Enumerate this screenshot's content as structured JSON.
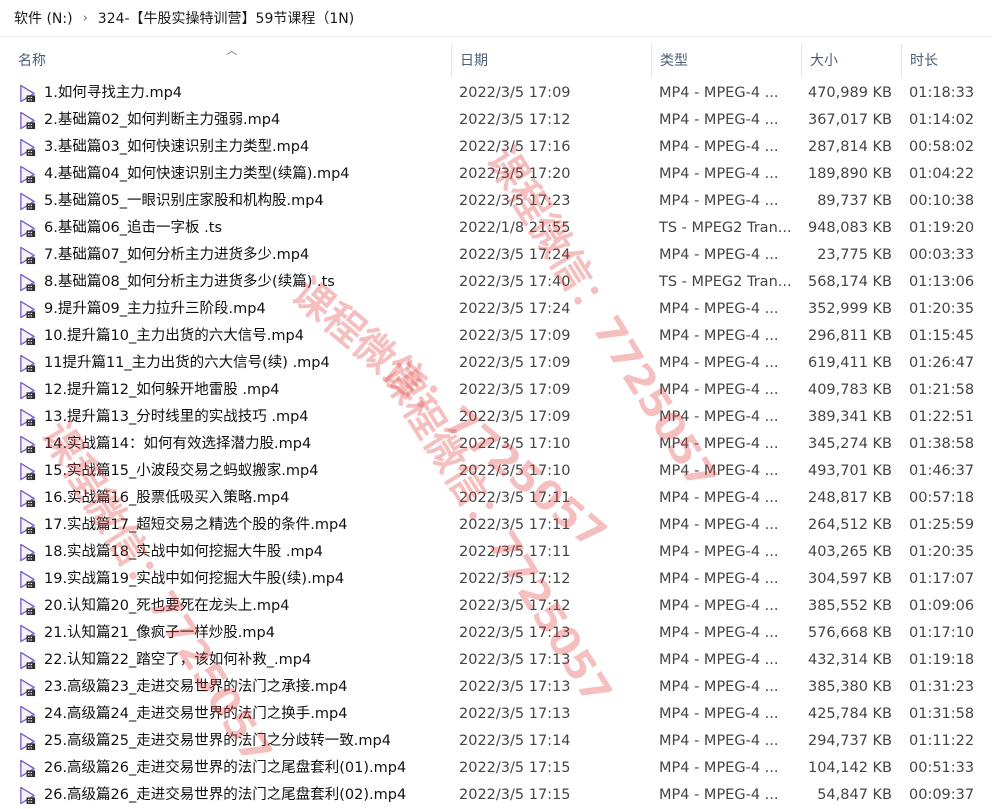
{
  "breadcrumb": [
    "软件 (N:)",
    "324-【牛股实操特训营】59节课程（1N)"
  ],
  "columns": {
    "name": "名称",
    "date": "日期",
    "type": "类型",
    "size": "大小",
    "duration": "时长"
  },
  "rows": [
    {
      "name": "1.如何寻找主力.mp4",
      "date": "2022/3/5 17:09",
      "type": "MP4 - MPEG-4 ...",
      "size": "470,989 KB",
      "duration": "01:18:33",
      "icon": "video-file-icon"
    },
    {
      "name": "2.基础篇02_如何判断主力强弱.mp4",
      "date": "2022/3/5 17:12",
      "type": "MP4 - MPEG-4 ...",
      "size": "367,017 KB",
      "duration": "01:14:02",
      "icon": "video-file-icon"
    },
    {
      "name": "3.基础篇03_如何快速识别主力类型.mp4",
      "date": "2022/3/5 17:16",
      "type": "MP4 - MPEG-4 ...",
      "size": "287,814 KB",
      "duration": "00:58:02",
      "icon": "video-file-icon"
    },
    {
      "name": "4.基础篇04_如何快速识别主力类型(续篇).mp4",
      "date": "2022/3/5 17:20",
      "type": "MP4 - MPEG-4 ...",
      "size": "189,890 KB",
      "duration": "01:04:22",
      "icon": "video-file-icon"
    },
    {
      "name": "5.基础篇05_一眼识别庄家股和机构股.mp4",
      "date": "2022/3/5 17:23",
      "type": "MP4 - MPEG-4 ...",
      "size": "89,737 KB",
      "duration": "00:10:38",
      "icon": "video-file-icon"
    },
    {
      "name": "6.基础篇06_追击一字板 .ts",
      "date": "2022/1/8 21:55",
      "type": "TS - MPEG2 Tran...",
      "size": "948,083 KB",
      "duration": "01:19:20",
      "icon": "video-file-icon"
    },
    {
      "name": "7.基础篇07_如何分析主力进货多少.mp4",
      "date": "2022/3/5 17:24",
      "type": "MP4 - MPEG-4 ...",
      "size": "23,775 KB",
      "duration": "00:03:33",
      "icon": "video-file-icon"
    },
    {
      "name": "8.基础篇08_如何分析主力进货多少(续篇) .ts",
      "date": "2022/3/5 17:40",
      "type": "TS - MPEG2 Tran...",
      "size": "568,174 KB",
      "duration": "01:13:06",
      "icon": "video-file-icon"
    },
    {
      "name": "9.提升篇09_主力拉升三阶段.mp4",
      "date": "2022/3/5 17:24",
      "type": "MP4 - MPEG-4 ...",
      "size": "352,999 KB",
      "duration": "01:20:35",
      "icon": "video-file-icon"
    },
    {
      "name": "10.提升篇10_主力出货的六大信号.mp4",
      "date": "2022/3/5 17:09",
      "type": "MP4 - MPEG-4 ...",
      "size": "296,811 KB",
      "duration": "01:15:45",
      "icon": "video-file-icon"
    },
    {
      "name": "11提升篇11_主力出货的六大信号(续) .mp4",
      "date": "2022/3/5 17:09",
      "type": "MP4 - MPEG-4 ...",
      "size": "619,411 KB",
      "duration": "01:26:47",
      "icon": "video-file-icon"
    },
    {
      "name": "12.提升篇12_如何躲开地雷股 .mp4",
      "date": "2022/3/5 17:09",
      "type": "MP4 - MPEG-4 ...",
      "size": "409,783 KB",
      "duration": "01:21:58",
      "icon": "video-file-icon"
    },
    {
      "name": "13.提升篇13_分时线里的实战技巧 .mp4",
      "date": "2022/3/5 17:09",
      "type": "MP4 - MPEG-4 ...",
      "size": "389,341 KB",
      "duration": "01:22:51",
      "icon": "video-file-icon"
    },
    {
      "name": "14.实战篇14：如何有效选择潜力股.mp4",
      "date": "2022/3/5 17:10",
      "type": "MP4 - MPEG-4 ...",
      "size": "345,274 KB",
      "duration": "01:38:58",
      "icon": "video-file-icon"
    },
    {
      "name": "15.实战篇15_小波段交易之蚂蚁搬家.mp4",
      "date": "2022/3/5 17:10",
      "type": "MP4 - MPEG-4 ...",
      "size": "493,701 KB",
      "duration": "01:46:37",
      "icon": "video-file-icon"
    },
    {
      "name": "16.实战篇16_股票低吸买入策略.mp4",
      "date": "2022/3/5 17:11",
      "type": "MP4 - MPEG-4 ...",
      "size": "248,817 KB",
      "duration": "00:57:18",
      "icon": "video-file-icon"
    },
    {
      "name": "17.实战篇17_超短交易之精选个股的条件.mp4",
      "date": "2022/3/5 17:11",
      "type": "MP4 - MPEG-4 ...",
      "size": "264,512 KB",
      "duration": "01:25:59",
      "icon": "video-file-icon"
    },
    {
      "name": "18.实战篇18_实战中如何挖掘大牛股 .mp4",
      "date": "2022/3/5 17:11",
      "type": "MP4 - MPEG-4 ...",
      "size": "403,265 KB",
      "duration": "01:20:35",
      "icon": "video-file-icon"
    },
    {
      "name": "19.实战篇19_实战中如何挖掘大牛股(续).mp4",
      "date": "2022/3/5 17:12",
      "type": "MP4 - MPEG-4 ...",
      "size": "304,597 KB",
      "duration": "01:17:07",
      "icon": "video-file-icon"
    },
    {
      "name": "20.认知篇20_死也要死在龙头上.mp4",
      "date": "2022/3/5 17:12",
      "type": "MP4 - MPEG-4 ...",
      "size": "385,552 KB",
      "duration": "01:09:06",
      "icon": "video-file-icon"
    },
    {
      "name": "21.认知篇21_像疯子一样炒股.mp4",
      "date": "2022/3/5 17:13",
      "type": "MP4 - MPEG-4 ...",
      "size": "576,668 KB",
      "duration": "01:17:10",
      "icon": "video-file-icon"
    },
    {
      "name": "22.认知篇22_踏空了，该如何补救_.mp4",
      "date": "2022/3/5 17:13",
      "type": "MP4 - MPEG-4 ...",
      "size": "432,314 KB",
      "duration": "01:19:18",
      "icon": "video-file-icon"
    },
    {
      "name": "23.高级篇23_走进交易世界的法门之承接.mp4",
      "date": "2022/3/5 17:13",
      "type": "MP4 - MPEG-4 ...",
      "size": "385,380 KB",
      "duration": "01:31:23",
      "icon": "video-file-icon"
    },
    {
      "name": "24.高级篇24_走进交易世界的法门之换手.mp4",
      "date": "2022/3/5 17:13",
      "type": "MP4 - MPEG-4 ...",
      "size": "425,784 KB",
      "duration": "01:31:58",
      "icon": "video-file-icon"
    },
    {
      "name": "25.高级篇25_走进交易世界的法门之分歧转一致.mp4",
      "date": "2022/3/5 17:14",
      "type": "MP4 - MPEG-4 ...",
      "size": "294,737 KB",
      "duration": "01:11:22",
      "icon": "video-file-icon"
    },
    {
      "name": "26.高级篇26_走进交易世界的法门之尾盘套利(01).mp4",
      "date": "2022/3/5 17:15",
      "type": "MP4 - MPEG-4 ...",
      "size": "104,142 KB",
      "duration": "00:51:33",
      "icon": "video-file-icon"
    },
    {
      "name": "26.高级篇26_走进交易世界的法门之尾盘套利(02).mp4",
      "date": "2022/3/5 17:15",
      "type": "MP4 - MPEG-4 ...",
      "size": "54,847 KB",
      "duration": "00:09:37",
      "icon": "video-file-icon"
    }
  ],
  "watermarks": [
    "课程微信：7725057",
    "课程微信：7725057",
    "课程微信：7725057",
    "课程微信：7725057"
  ],
  "colors": {
    "watermark": "#e13c3c",
    "icon_accent": "#7b5ec6",
    "header_text": "#4c607a"
  }
}
